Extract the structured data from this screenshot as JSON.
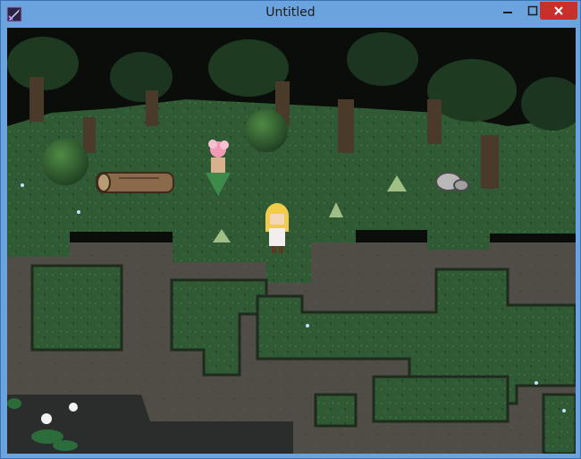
{
  "window": {
    "title": "Untitled",
    "controls": {
      "minimize": "minimize",
      "maximize": "maximize",
      "close": "close"
    }
  },
  "colors": {
    "titlebar": "#6aa3dd",
    "close_button": "#c7302b",
    "canopy": "#0a0d0a",
    "grass": "#2f5a33",
    "swamp": "#4f4d45",
    "water": "#2b2d2c"
  },
  "scene": {
    "type": "forest-swamp map",
    "characters": [
      "blonde-heroine",
      "flower-dryad"
    ],
    "objects": [
      "fallen-log",
      "grey-rock",
      "water-lilies",
      "sparkles"
    ]
  }
}
